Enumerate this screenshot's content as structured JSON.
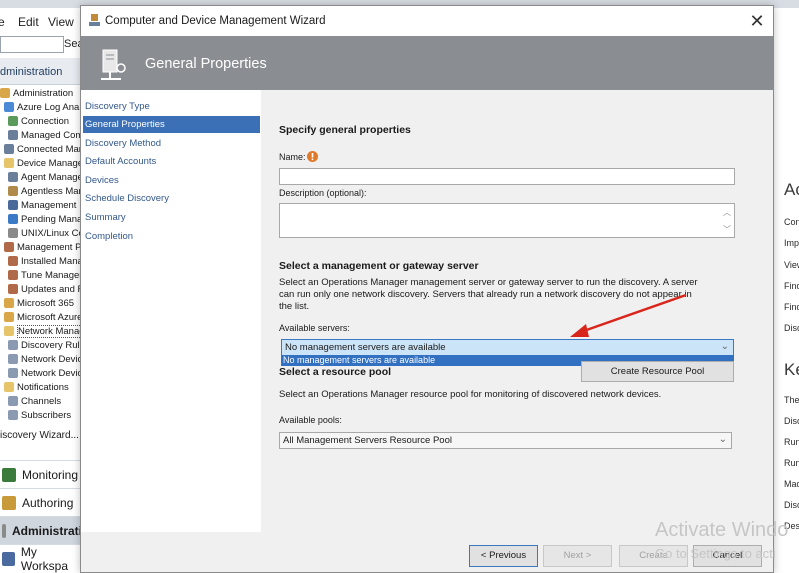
{
  "console": {
    "menu": [
      "e",
      "Edit",
      "View"
    ],
    "search_label": "Sea",
    "section_title": "dministration",
    "tree": [
      "Administration",
      "Azure Log Analy",
      "Connection",
      "Managed Com",
      "Connected Man",
      "Device Manage",
      "Agent Manage",
      "Agentless Man",
      "Management",
      "Pending Mana",
      "UNIX/Linux Co",
      "Management Pa",
      "Installed Mana",
      "Tune Manager",
      "Updates and F",
      "Microsoft 365",
      "Microsoft Azure",
      "Network Manag",
      "Discovery Rule",
      "Network Devic",
      "Network Devic",
      "Notifications",
      "Channels",
      "Subscribers"
    ],
    "discovery_wizard_link": "iscovery Wizard...",
    "workspaces": [
      "Monitoring",
      "Authoring",
      "Administrati",
      "My Workspa"
    ],
    "right_pane": {
      "heading1": "Ac",
      "items1": [
        "Con",
        "Imp",
        "View",
        "Find",
        "Find",
        "Disc"
      ],
      "heading2": "Ke",
      "items2": [
        "The",
        "Disc",
        "Run",
        "Run",
        "Mad",
        "Disc",
        "Des"
      ]
    },
    "watermark": {
      "line1": "Activate Windo",
      "line2": "Go to Settings to acti"
    }
  },
  "wizard": {
    "window_title": "Computer and Device Management Wizard",
    "close_glyph": "✕",
    "banner_title": "General Properties",
    "nav": [
      {
        "label": "Discovery Type",
        "active": false
      },
      {
        "label": "General Properties",
        "active": true
      },
      {
        "label": "Discovery Method",
        "active": false
      },
      {
        "label": "Default Accounts",
        "active": false
      },
      {
        "label": "Devices",
        "active": false
      },
      {
        "label": "Schedule Discovery",
        "active": false
      },
      {
        "label": "Summary",
        "active": false
      },
      {
        "label": "Completion",
        "active": false
      }
    ],
    "general": {
      "heading": "Specify general properties",
      "name_label": "Name:",
      "name_value": "",
      "description_label": "Description (optional):",
      "description_value": ""
    },
    "server": {
      "heading": "Select a management or gateway server",
      "description": "Select an Operations Manager management server or gateway server to run the discovery. A server can run only one network discovery. Servers that already run a network discovery do not appear in the list.",
      "available_label": "Available servers:",
      "selected": "No management servers are available",
      "dropdown_option": "No management servers are available"
    },
    "pool": {
      "heading": "Select a resource pool",
      "create_button": "Create Resource Pool",
      "description": "Select an Operations Manager resource pool for monitoring of discovered network devices.",
      "available_label": "Available pools:",
      "selected": "All Management Servers Resource Pool"
    },
    "buttons": {
      "previous": "< Previous",
      "next": "Next >",
      "create": "Create",
      "cancel": "Cancel"
    }
  },
  "colors": {
    "banner": "#8a8e93",
    "nav_active": "#3b6fb6",
    "dropdown_highlight": "#3271c1",
    "annotation_arrow": "#d9261c"
  },
  "icons": [
    "wizard-app-icon",
    "wizard-banner-icon",
    "warning-icon",
    "close-icon",
    "red-arrow-annotation"
  ]
}
